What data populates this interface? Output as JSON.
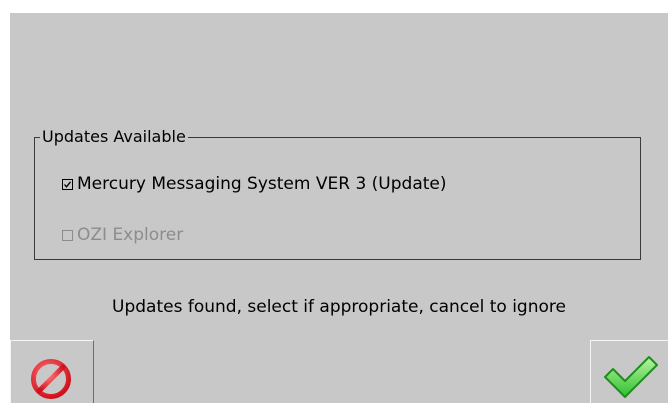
{
  "dialog": {
    "group_title": "Updates Available",
    "updates": [
      {
        "label": "Mercury Messaging System VER 3 (Update)",
        "checked": true,
        "enabled": true
      },
      {
        "label": "OZI Explorer",
        "checked": false,
        "enabled": false
      }
    ],
    "message": "Updates found, select if appropriate, cancel to ignore"
  },
  "buttons": {
    "cancel": {
      "icon": "cancel-icon",
      "color": "#e0202a"
    },
    "confirm": {
      "icon": "checkmark-icon",
      "color": "#34c234"
    }
  },
  "colors": {
    "background": "#c8c8c8",
    "disabled_text": "#8c8c8c"
  }
}
